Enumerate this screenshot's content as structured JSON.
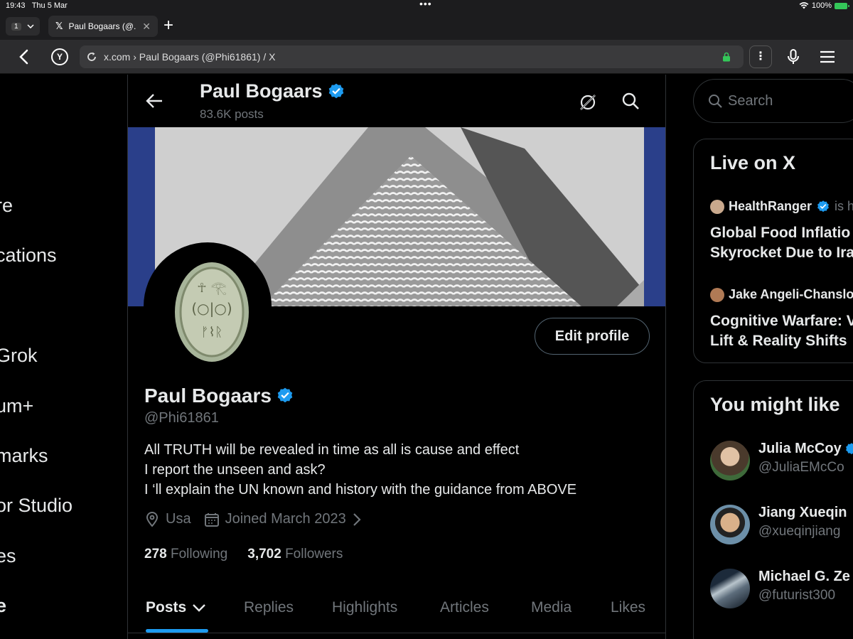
{
  "status_bar": {
    "time": "19:43",
    "date": "Thu 5 Mar",
    "battery": "100%"
  },
  "browser": {
    "tab_count": "1",
    "tab_title": "Paul Bogaars (@...",
    "url": "x.com › Paul Bogaars (@Phi61861) / X",
    "y_label": "Y"
  },
  "left_nav": {
    "items": [
      "re",
      "cations",
      "Grok",
      "um+",
      "marks",
      "or Studio",
      "es",
      "e"
    ]
  },
  "header": {
    "name": "Paul Bogaars",
    "posts_count": "83.6K posts"
  },
  "profile": {
    "edit_button": "Edit profile",
    "name": "Paul Bogaars",
    "handle": "@Phi61861",
    "bio_lines": [
      "All TRUTH will be revealed in time as all is cause and effect",
      "I report the unseen and ask?",
      "I ‘ll explain the UN known and history with the guidance from ABOVE"
    ],
    "location": "Usa",
    "joined": "Joined March 2023",
    "following_count": "278",
    "following_label": "Following",
    "followers_count": "3,702",
    "followers_label": "Followers"
  },
  "tabs": [
    "Posts",
    "Replies",
    "Highlights",
    "Articles",
    "Media",
    "Likes"
  ],
  "right": {
    "search_placeholder": "Search",
    "live": {
      "title": "Live on X",
      "items": [
        {
          "host": "HealthRanger",
          "suffix": "is h",
          "title_lines": [
            "Global Food Inflatio",
            "Skyrocket Due to Ira"
          ]
        },
        {
          "host": "Jake Angeli-Chanslo",
          "suffix": "",
          "title_lines": [
            "Cognitive Warfare: V",
            "Lift & Reality Shifts"
          ]
        }
      ]
    },
    "suggestions": {
      "title": "You might like",
      "items": [
        {
          "name": "Julia McCoy",
          "handle": "@JuliaEMcCo"
        },
        {
          "name": "Jiang Xueqin",
          "handle": "@xueqinjiang"
        },
        {
          "name": "Michael G. Ze",
          "handle": "@futurist300"
        }
      ]
    }
  },
  "colors": {
    "background": "#000000",
    "accent": "#1d9bf0",
    "muted_text": "#71767b",
    "border": "#2f3336",
    "verified": "#1d9bf0"
  }
}
